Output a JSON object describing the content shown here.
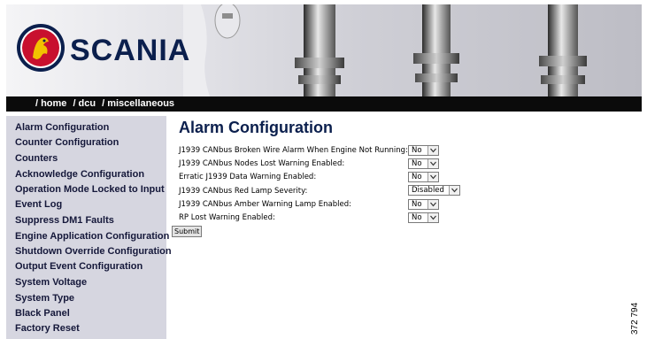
{
  "brand": {
    "logo_text": "SCANIA"
  },
  "breadcrumb": [
    "home",
    "dcu",
    "miscellaneous"
  ],
  "sidebar": {
    "items": [
      "Alarm Configuration",
      "Counter Configuration",
      "Counters",
      "Acknowledge Configuration",
      "Operation Mode Locked to Input",
      "Event Log",
      "Suppress DM1 Faults",
      "Engine Application Configuration",
      "Shutdown Override Configuration",
      "Output Event Configuration",
      "System Voltage",
      "System Type",
      "Black Panel",
      "Factory Reset"
    ]
  },
  "main": {
    "title": "Alarm Configuration",
    "fields": [
      {
        "label": "J1939 CANbus Broken Wire Alarm When Engine Not Running:",
        "value": "No"
      },
      {
        "label": "J1939 CANbus Nodes Lost Warning Enabled:",
        "value": "No"
      },
      {
        "label": "Erratic J1939 Data Warning Enabled:",
        "value": "No"
      },
      {
        "label": "J1939 CANbus Red Lamp Severity:",
        "value": "Disabled"
      },
      {
        "label": "J1939 CANbus Amber Warning Lamp Enabled:",
        "value": "No"
      },
      {
        "label": "RP Lost Warning Enabled:",
        "value": "No"
      }
    ],
    "submit_label": "Submit"
  },
  "figure_number": "372 794"
}
